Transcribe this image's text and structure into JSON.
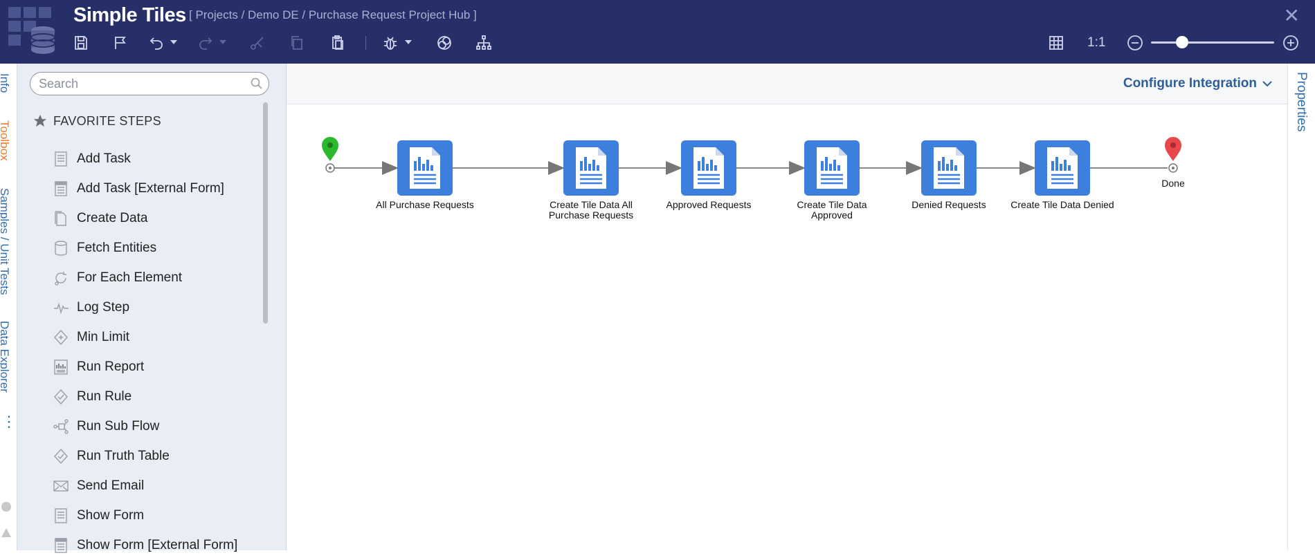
{
  "app": {
    "title": "Simple Tiles",
    "breadcrumb": "[ Projects / Demo DE / Purchase Request Project Hub ]",
    "zoom_ratio": "1:1",
    "zoom_level": 0.25
  },
  "toolbar": {
    "icons": [
      "save-icon",
      "flag-icon",
      "undo-icon",
      "redo-icon",
      "cut-icon",
      "copy-icon",
      "paste-icon",
      "debug-icon",
      "overlap-icon",
      "hierarchy-icon",
      "grid-icon",
      "zoom-out-icon",
      "zoom-in-icon",
      "close-icon"
    ]
  },
  "left_tabs": {
    "info": "Info",
    "toolbox": "Toolbox",
    "samples": "Samples / Unit Tests",
    "data_explorer": "Data Explorer"
  },
  "toolbox": {
    "search_placeholder": "Search",
    "favorites_heading": "FAVORITE STEPS",
    "steps": [
      {
        "label": "Add Task",
        "icon": "form-icon"
      },
      {
        "label": "Add Task [External Form]",
        "icon": "external-form-icon"
      },
      {
        "label": "Create Data",
        "icon": "pages-icon"
      },
      {
        "label": "Fetch Entities",
        "icon": "database-icon"
      },
      {
        "label": "For Each Element",
        "icon": "loop-icon"
      },
      {
        "label": "Log Step",
        "icon": "pulse-icon"
      },
      {
        "label": "Min Limit",
        "icon": "diamond-icon"
      },
      {
        "label": "Run Report",
        "icon": "report-icon"
      },
      {
        "label": "Run Rule",
        "icon": "rule-icon"
      },
      {
        "label": "Run Sub Flow",
        "icon": "subflow-icon"
      },
      {
        "label": "Run Truth Table",
        "icon": "truth-table-icon"
      },
      {
        "label": "Send Email",
        "icon": "email-icon"
      },
      {
        "label": "Show Form",
        "icon": "form-icon"
      },
      {
        "label": "Show Form [External Form]",
        "icon": "external-form-icon"
      }
    ]
  },
  "canvas": {
    "configure_label": "Configure Integration",
    "start_color": "#2db82d",
    "end_color": "#e8474c",
    "node_color": "#3d7fdc",
    "end_label": "Done",
    "nodes": [
      {
        "label": "All Purchase Requests"
      },
      {
        "label": "Create Tile Data All\nPurchase Requests"
      },
      {
        "label": "Approved Requests"
      },
      {
        "label": "Create Tile Data\nApproved"
      },
      {
        "label": "Denied Requests"
      },
      {
        "label": "Create Tile Data Denied"
      }
    ]
  },
  "right_tab": {
    "properties": "Properties"
  }
}
